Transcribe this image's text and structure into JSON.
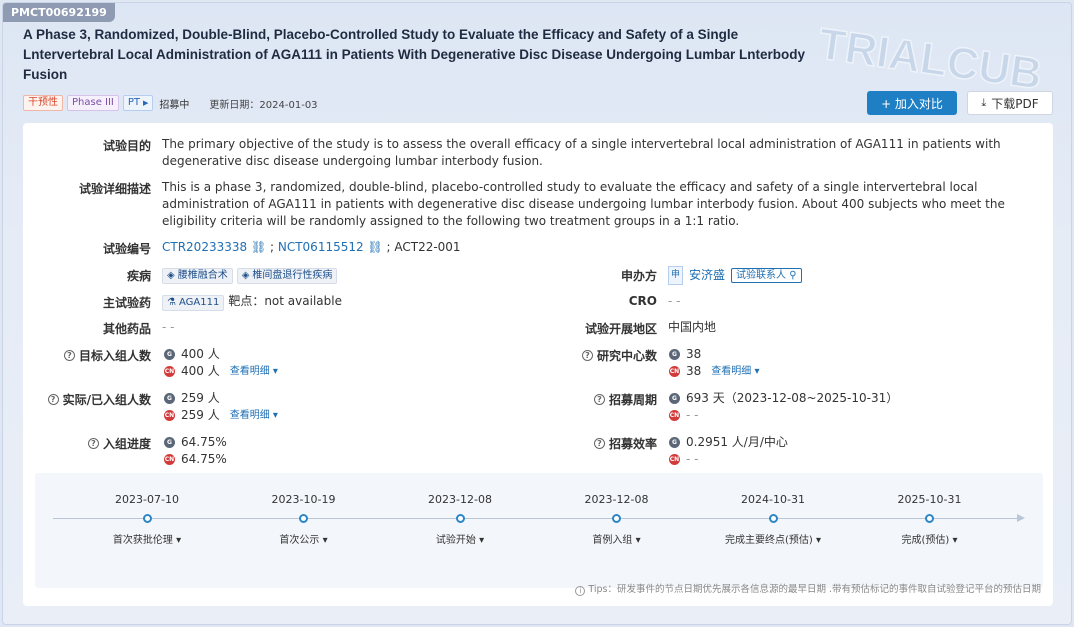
{
  "header": {
    "id_badge": "PMCT00692199",
    "title": "A Phase 3, Randomized, Double-Blind, Placebo-Controlled Study to Evaluate the Efficacy and Safety of a Single Lntervertebral Local Administration of AGA111 in Patients With Degenerative Disc Disease Undergoing Lumbar Lnterbody Fusion",
    "tags": {
      "intervention": "干预性",
      "phase": "Phase III",
      "pt": "PT",
      "status": "招募中"
    },
    "update_label": "更新日期：",
    "update_date": "2024-01-03",
    "add_compare": "+ 加入对比",
    "download_pdf": "下载PDF",
    "watermark_text": "TRIALCUBE"
  },
  "fields": {
    "purpose_label": "试验目的",
    "purpose": "The primary objective of the study is to assess the overall efficacy of a single intervertebral local administration of AGA111 in patients with degenerative disc disease undergoing lumbar interbody fusion.",
    "description_label": "试验详细描述",
    "description": "This is a phase 3, randomized, double-blind, placebo-controlled study to evaluate the efficacy and safety of a single intervertebral local administration of AGA111 in patients with degenerative disc disease undergoing lumbar interbody fusion. About 400 subjects who meet the eligibility criteria will be randomly assigned to the following two treatment groups in a 1:1 ratio.",
    "trial_no_label": "试验编号",
    "trial_no_1": "CTR20233338",
    "trial_no_sep": " ; ",
    "trial_no_2": "NCT06115512",
    "trial_no_3": " ; ACT22-001",
    "disease_label": "疾病",
    "disease_1": "腰椎融合术",
    "disease_2": "椎间盘退行性疾病",
    "sponsor_label": "申办方",
    "sponsor_badge": "申",
    "sponsor": "安济盛",
    "sponsor_contact": "试验联系人",
    "main_drug_label": "主试验药",
    "main_drug": "AGA111",
    "target_label": "靶点：",
    "target": "not available",
    "cro_label": "CRO",
    "cro": "- -",
    "other_drug_label": "其他药品",
    "other_drug": "- -",
    "region_label": "试验开展地区",
    "region": "中国内地",
    "target_enroll_label": "目标入组人数",
    "target_enroll_global": "400 人",
    "target_enroll_cn": "400 人",
    "center_label": "研究中心数",
    "center_global": "38",
    "center_cn": "38",
    "actual_enroll_label": "实际/已入组人数",
    "actual_enroll_global": "259 人",
    "actual_enroll_cn": "259 人",
    "recruit_period_label": "招募周期",
    "recruit_period_global": "693 天（2023-12-08~2025-10-31）",
    "recruit_period_cn": "- -",
    "progress_label": "入组进度",
    "progress_global": "64.75%",
    "progress_cn": "64.75%",
    "efficiency_label": "招募效率",
    "efficiency_global": "0.2951 人/月/中心",
    "efficiency_cn": "- -",
    "view_detail": "查看明细",
    "global_icon": "G",
    "cn_icon": "CN"
  },
  "timeline": [
    {
      "date": "2023-07-10",
      "label": "首次获批伦理"
    },
    {
      "date": "2023-10-19",
      "label": "首次公示"
    },
    {
      "date": "2023-12-08",
      "label": "试验开始"
    },
    {
      "date": "2023-12-08",
      "label": "首例入组"
    },
    {
      "date": "2024-10-31",
      "label": "完成主要终点(预估)"
    },
    {
      "date": "2025-10-31",
      "label": "完成(预估)"
    }
  ],
  "tips": "Tips：研发事件的节点日期优先展示各信息源的最早日期 .带有预估标记的事件取自试验登记平台的预估日期",
  "colors": {
    "accent": "#1f7fc4",
    "cn_red": "#d33a3a"
  }
}
